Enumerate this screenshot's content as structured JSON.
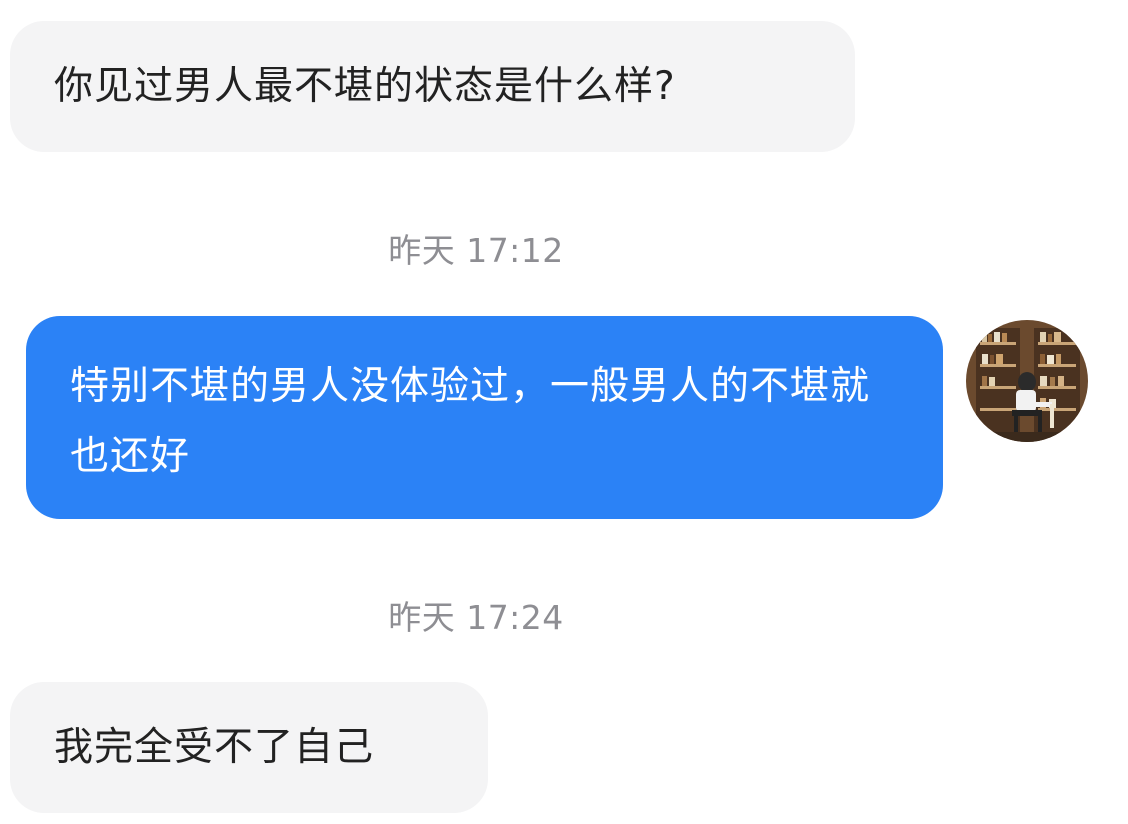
{
  "messages": [
    {
      "direction": "incoming",
      "text": "你见过男人最不堪的状态是什么样?"
    },
    {
      "direction": "outgoing",
      "text": "特别不堪的男人没体验过，一般男人的不堪就也还好"
    },
    {
      "direction": "incoming",
      "text": "我完全受不了自己"
    }
  ],
  "timestamps": [
    "昨天 17:12",
    "昨天 17:24"
  ],
  "avatar": {
    "icon": "user-avatar-bookshelf-photo"
  },
  "colors": {
    "incoming_bubble": "#f4f4f5",
    "outgoing_bubble": "#2b82f6",
    "timestamp_text": "#8e8e93"
  }
}
